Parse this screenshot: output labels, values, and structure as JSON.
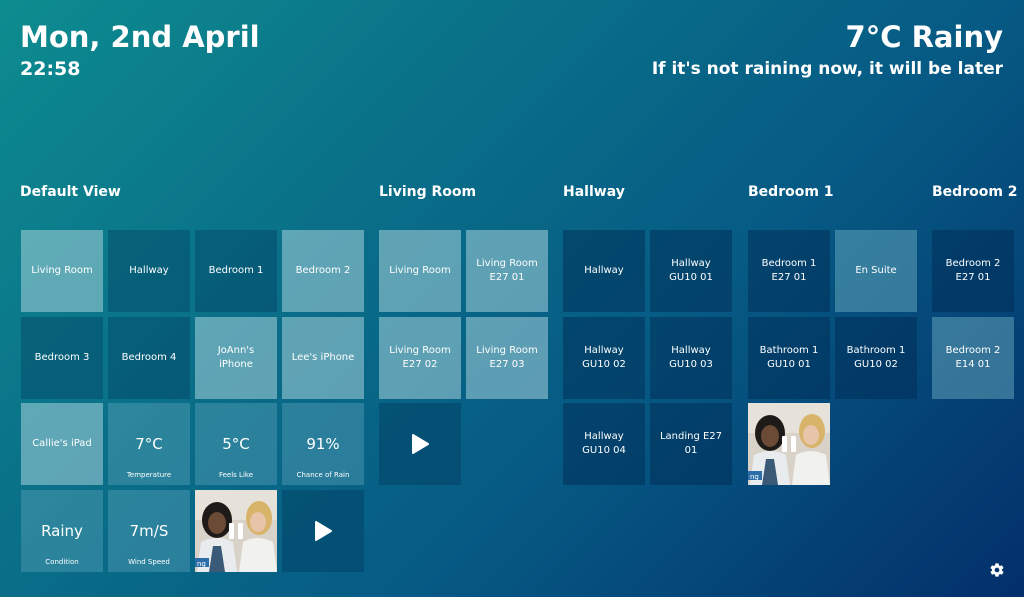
{
  "header": {
    "date": "Mon, 2nd April",
    "time": "22:58",
    "weather": "7°C Rainy",
    "quip": "If it's not raining now, it will be later"
  },
  "groups": [
    {
      "title": "Default View",
      "tiles": [
        {
          "label": "Living Room",
          "state": "on"
        },
        {
          "label": "Hallway",
          "state": "off"
        },
        {
          "label": "Bedroom 1",
          "state": "off"
        },
        {
          "label": "Bedroom 2",
          "state": "on"
        },
        {
          "label": "Bedroom 3",
          "state": "off"
        },
        {
          "label": "Bedroom 4",
          "state": "off"
        },
        {
          "label": "JoAnn's iPhone",
          "state": "on"
        },
        {
          "label": "Lee's iPhone",
          "state": "on"
        },
        {
          "label": "Callie's iPad",
          "state": "on"
        },
        {
          "value": "7°C",
          "caption": "Temperature"
        },
        {
          "value": "5°C",
          "caption": "Feels Like"
        },
        {
          "value": "91%",
          "caption": "Chance of Rain"
        },
        {
          "value": "Rainy",
          "caption": "Condition"
        },
        {
          "value": "7m/S",
          "caption": "Wind Speed"
        },
        {
          "type": "media",
          "control": "pause-icon"
        },
        {
          "type": "media",
          "control": "play-icon"
        }
      ]
    },
    {
      "title": "Living Room",
      "tiles": [
        {
          "label": "Living Room",
          "state": "on"
        },
        {
          "label": "Living Room E27 01",
          "state": "on"
        },
        {
          "label": "Living Room E27 02",
          "state": "on"
        },
        {
          "label": "Living Room E27 03",
          "state": "on"
        },
        {
          "type": "media",
          "control": "play-icon"
        }
      ]
    },
    {
      "title": "Hallway",
      "tiles": [
        {
          "label": "Hallway",
          "state": "off"
        },
        {
          "label": "Hallway GU10 01",
          "state": "off"
        },
        {
          "label": "Hallway GU10 02",
          "state": "off"
        },
        {
          "label": "Hallway GU10 03",
          "state": "off"
        },
        {
          "label": "Hallway GU10 04",
          "state": "off"
        },
        {
          "label": "Landing E27 01",
          "state": "off"
        }
      ]
    },
    {
      "title": "Bedroom 1",
      "tiles": [
        {
          "label": "Bedroom 1 E27 01",
          "state": "off"
        },
        {
          "label": "En Suite",
          "state": "on"
        },
        {
          "label": "Bathroom 1 GU10 01",
          "state": "off"
        },
        {
          "label": "Bathroom 1 GU10 02",
          "state": "off"
        },
        {
          "type": "media",
          "control": "pause-icon"
        }
      ]
    },
    {
      "title": "Bedroom 2",
      "tiles": [
        {
          "label": "Bedroom 2 E27 01",
          "state": "off"
        },
        {
          "label": "Bedroom 2 E14 01",
          "state": "on"
        }
      ]
    }
  ],
  "settings_icon": "gear-icon"
}
